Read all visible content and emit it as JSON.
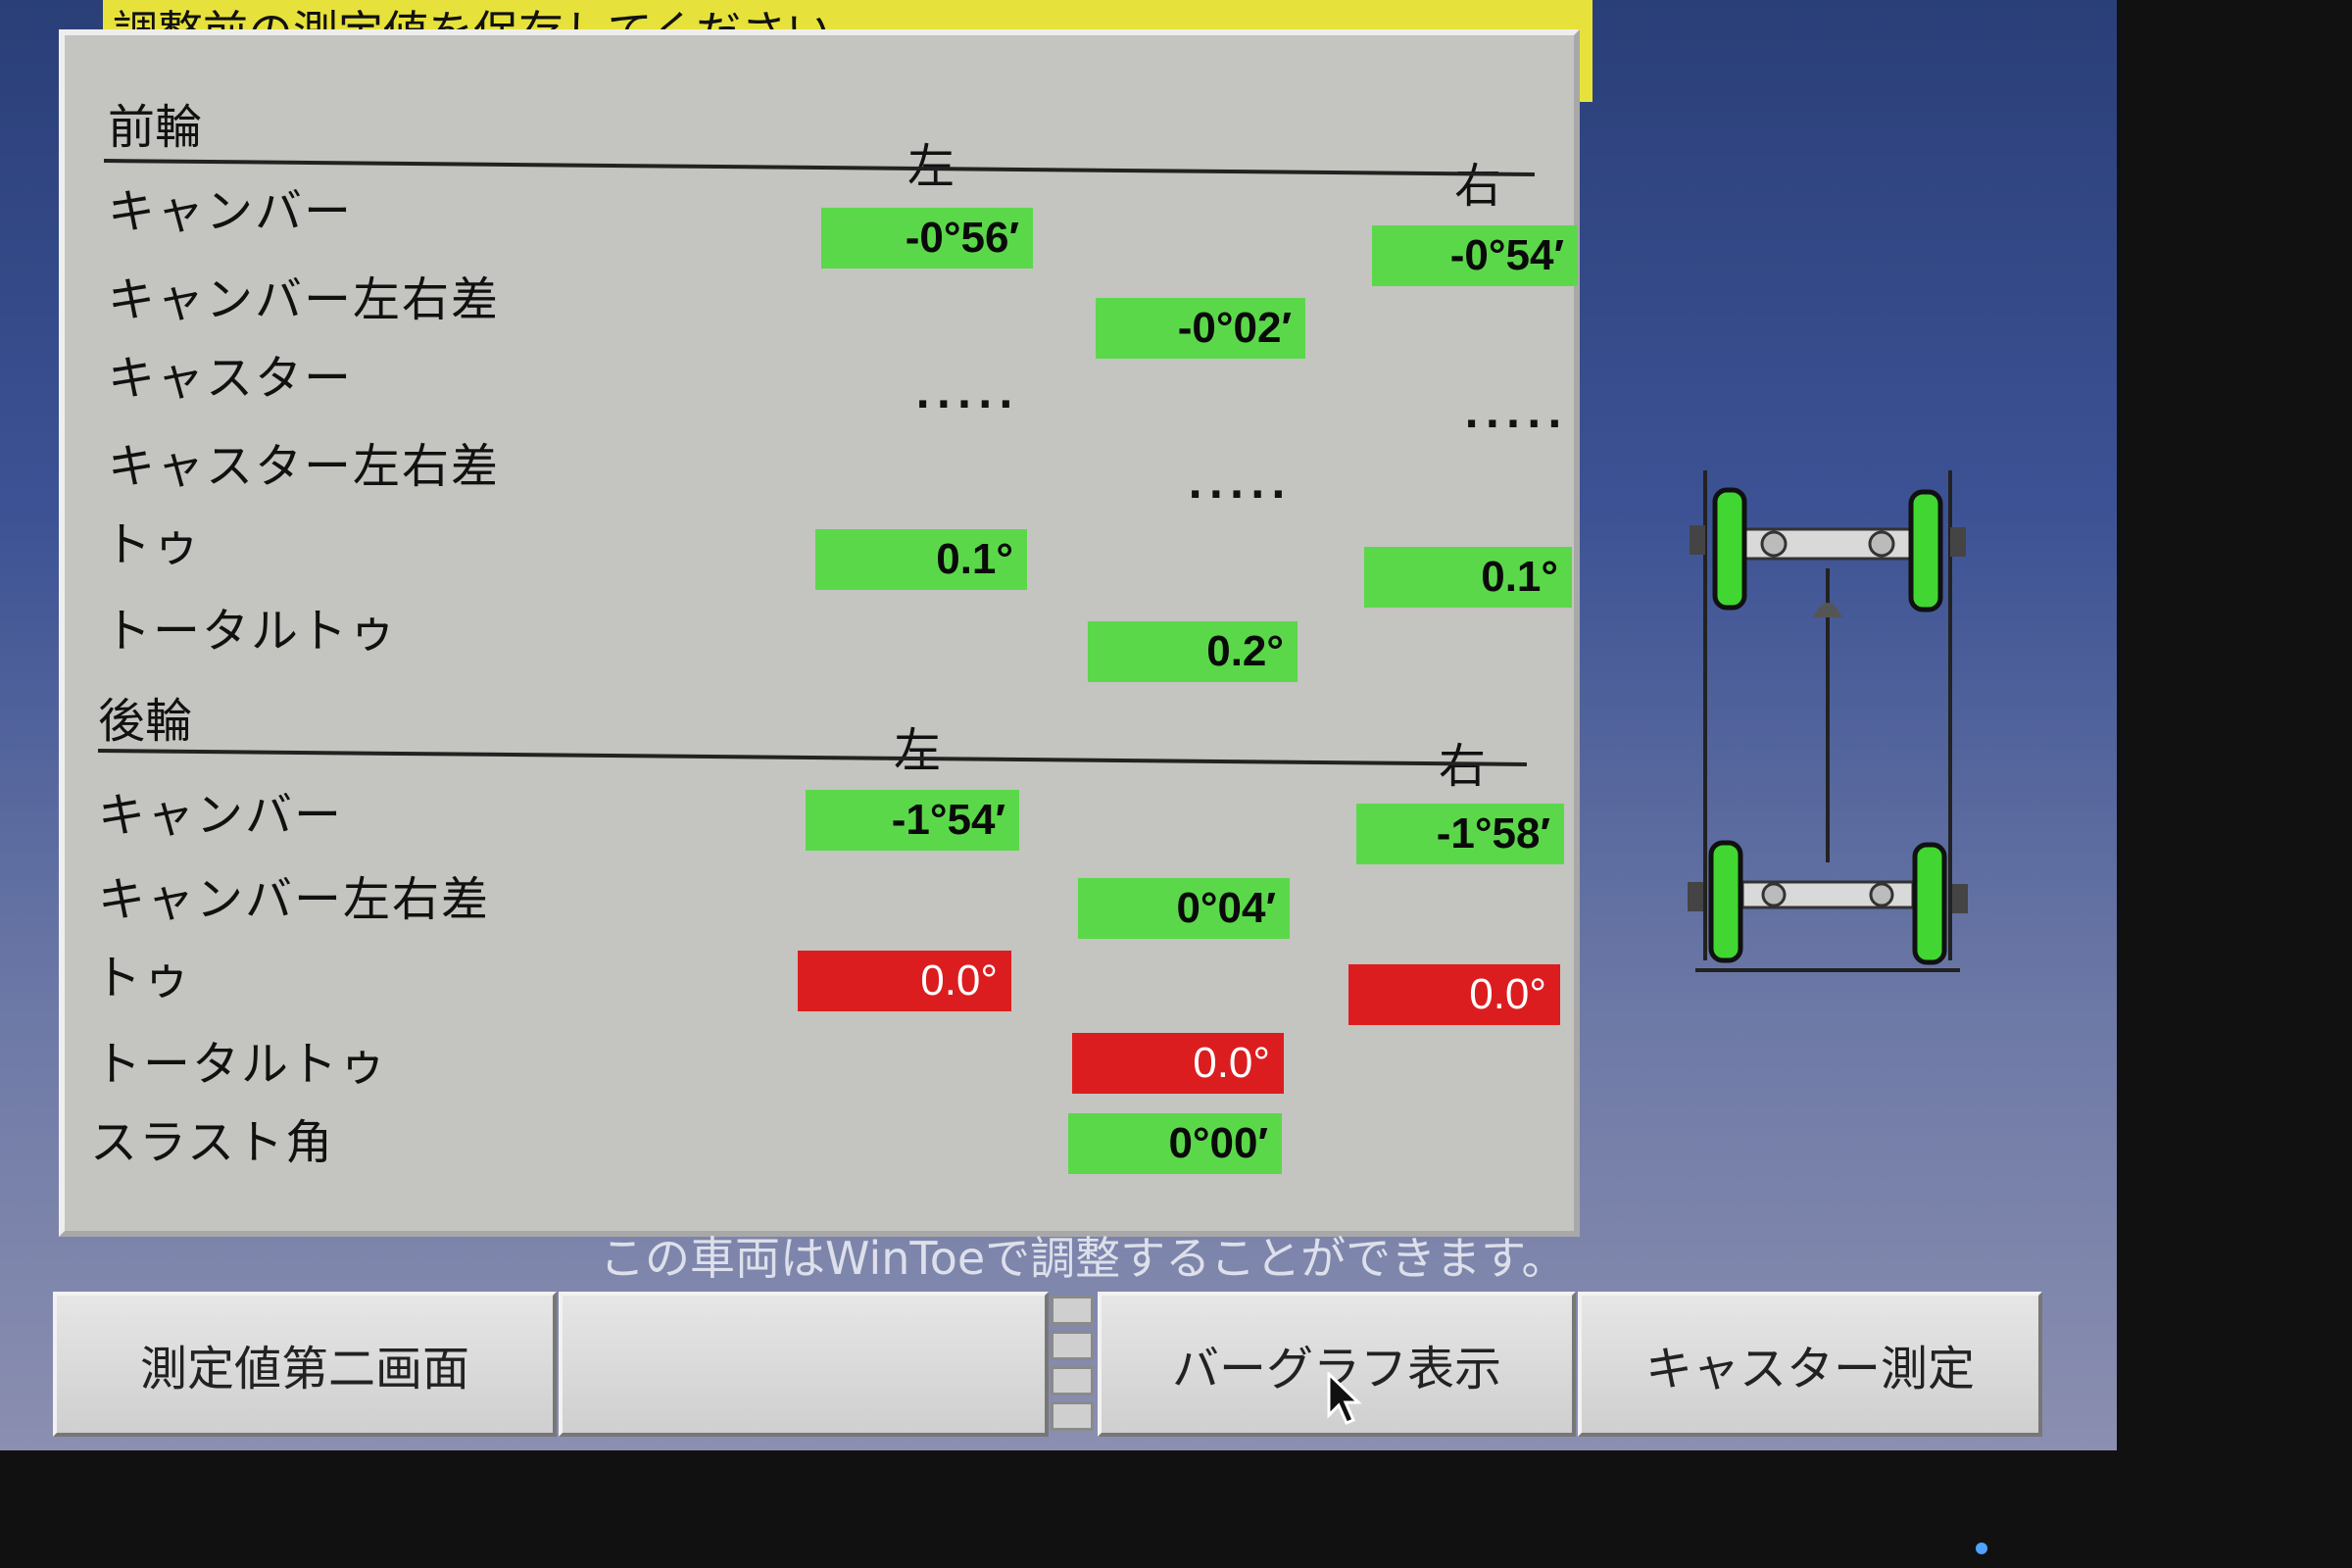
{
  "banner": "調整前の測定値を保存してください。",
  "front": {
    "title": "前輪",
    "left_header": "左",
    "right_header": "右",
    "rows": {
      "camber_label": "キャンバー",
      "camber_left": "-0°56′",
      "camber_right": "-0°54′",
      "camber_diff_label": "キャンバー左右差",
      "camber_diff": "-0°02′",
      "caster_label": "キャスター",
      "caster_left": "·····",
      "caster_right": "·····",
      "caster_diff_label": "キャスター左右差",
      "caster_diff": "·····",
      "toe_label": "トゥ",
      "toe_left": "0.1°",
      "toe_right": "0.1°",
      "total_toe_label": "トータルトゥ",
      "total_toe": "0.2°"
    }
  },
  "rear": {
    "title": "後輪",
    "left_header": "左",
    "right_header": "右",
    "rows": {
      "camber_label": "キャンバー",
      "camber_left": "-1°54′",
      "camber_right": "-1°58′",
      "camber_diff_label": "キャンバー左右差",
      "camber_diff": "0°04′",
      "toe_label": "トゥ",
      "toe_left": "0.0°",
      "toe_right": "0.0°",
      "total_toe_label": "トータルトゥ",
      "total_toe": "0.0°",
      "thrust_label": "スラスト角",
      "thrust": "0°00′"
    }
  },
  "note": "この車両はWinToeで調整することができます。",
  "buttons": {
    "measure2": "測定値第二画面",
    "blank": "",
    "bargraph": "バーグラフ表示",
    "caster": "キャスター測定"
  },
  "colors": {
    "ok_green": "#5bd84a",
    "bad_red": "#dc1d1f",
    "banner_yellow": "#e7e23b"
  }
}
